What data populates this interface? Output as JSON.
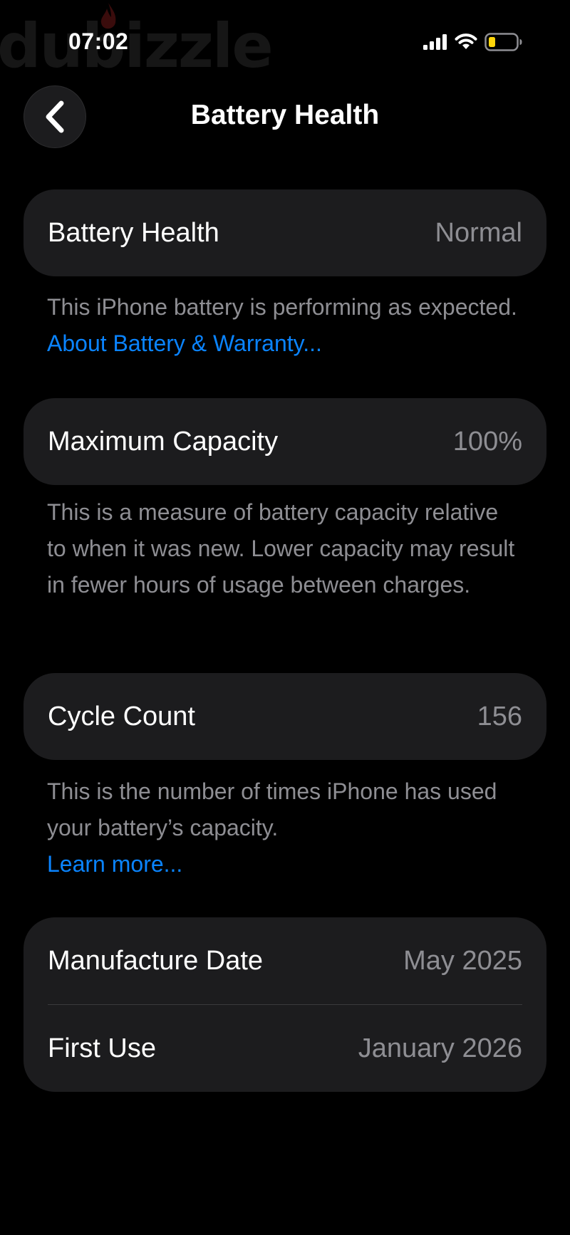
{
  "watermark": "dubizzle",
  "status_bar": {
    "time": "07:02",
    "icons": [
      "cellular-signal-icon",
      "wifi-icon",
      "battery-icon"
    ],
    "battery_color": "#ffd60a"
  },
  "nav": {
    "back_icon": "chevron-left-icon",
    "title": "Battery Health"
  },
  "sections": {
    "health": {
      "label": "Battery Health",
      "value": "Normal",
      "footnote": "This iPhone battery is performing as expected.",
      "link": "About Battery & Warranty..."
    },
    "capacity": {
      "label": "Maximum Capacity",
      "value": "100%",
      "footnote": "This is a measure of battery capacity relative to when it was new. Lower capacity may result in fewer hours of usage between charges."
    },
    "cycles": {
      "label": "Cycle Count",
      "value": "156",
      "footnote": "This is the number of times iPhone has used your battery’s capacity.",
      "link": "Learn more..."
    },
    "dates": {
      "manufacture_label": "Manufacture Date",
      "manufacture_value": "May 2025",
      "first_use_label": "First Use",
      "first_use_value": "January 2026"
    }
  },
  "colors": {
    "background": "#000000",
    "card": "#1c1c1e",
    "secondary_text": "#8e8e93",
    "link": "#0a84ff"
  }
}
